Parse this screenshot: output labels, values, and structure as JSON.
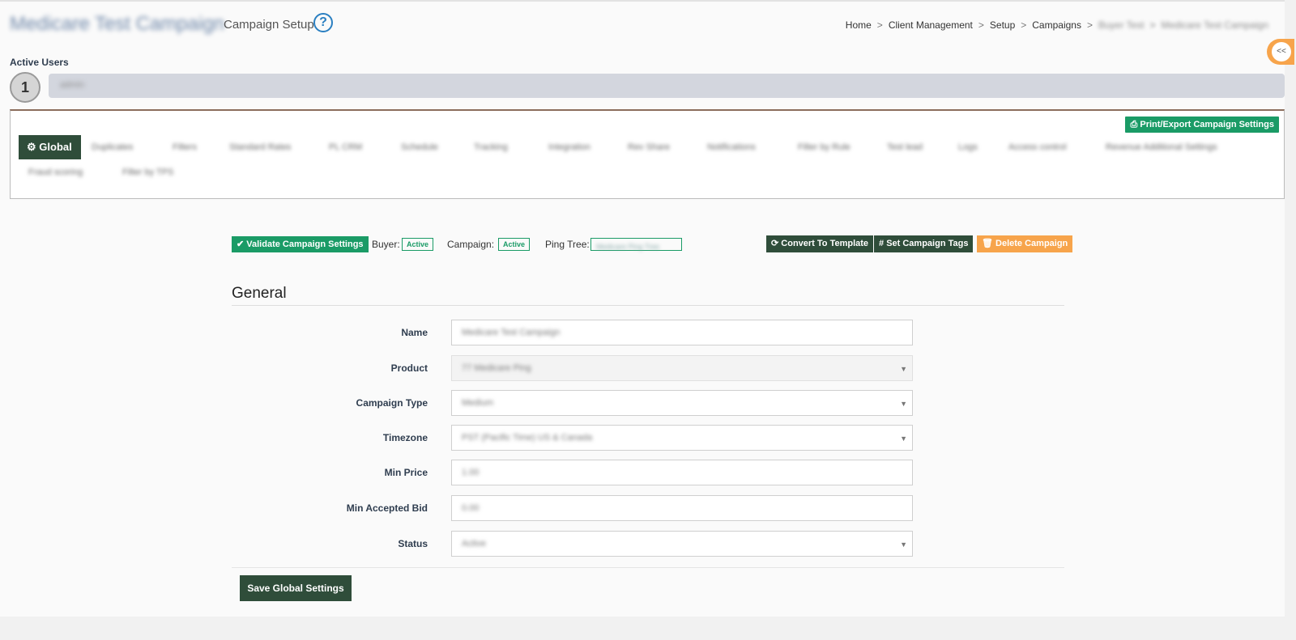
{
  "header": {
    "title": "Medicare Test Campaign",
    "subtitle": "Campaign Setup",
    "help_icon": "question-circle-icon"
  },
  "breadcrumb": {
    "items": [
      "Home",
      "Client Management",
      "Setup",
      "Campaigns",
      "Buyer Test",
      "Medicare Test Campaign"
    ],
    "separator": ">"
  },
  "sidebar_toggle": {
    "label": "<<"
  },
  "active_users": {
    "label": "Active Users",
    "count": "1",
    "user": "admin"
  },
  "tabs": {
    "export_label": "Print/Export Campaign Settings",
    "global_label": "Global",
    "items": [
      "Duplicates",
      "Filters",
      "Standard Rates",
      "PL CRM",
      "Schedule",
      "Tracking",
      "Integration",
      "Rev Share",
      "Notifications",
      "Filter by Rule",
      "Test lead",
      "Logs",
      "Access control",
      "Revenue Additional Settings",
      "Fraud scoring",
      "Filter by TPS"
    ]
  },
  "toolbar": {
    "validate_label": "Validate Campaign Settings",
    "buyer_label": "Buyer:",
    "buyer_status": "Active",
    "campaign_label": "Campaign:",
    "campaign_status": "Active",
    "ping_tree_label": "Ping Tree:",
    "ping_tree_value": "Medicare Ping Tree",
    "convert_label": "Convert To Template",
    "tags_label": "Set Campaign Tags",
    "delete_label": "Delete Campaign"
  },
  "general": {
    "section_title": "General",
    "fields": {
      "name": {
        "label": "Name",
        "value": "Medicare Test Campaign"
      },
      "product": {
        "label": "Product",
        "value": "77 Medicare Ping"
      },
      "campaign_type": {
        "label": "Campaign Type",
        "value": "Medium"
      },
      "timezone": {
        "label": "Timezone",
        "value": "PST (Pacific Time) US & Canada"
      },
      "min_price": {
        "label": "Min Price",
        "value": "1.00"
      },
      "min_accepted_bid": {
        "label": "Min Accepted Bid",
        "value": "0.00"
      },
      "status": {
        "label": "Status",
        "value": "Active"
      }
    },
    "save_label": "Save Global Settings"
  },
  "colors": {
    "accent_green": "#1a9b66",
    "dark_green": "#2f4d3a",
    "orange": "#f7a44b",
    "help_blue": "#2a7fc1"
  }
}
